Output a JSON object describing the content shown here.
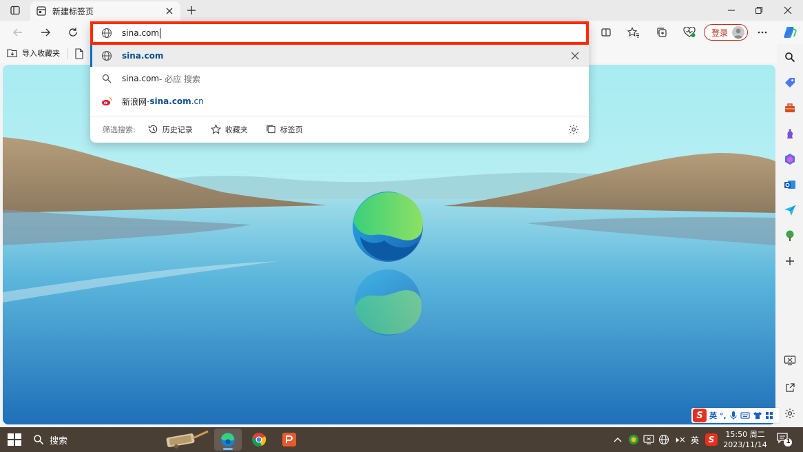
{
  "tab": {
    "title": "新建标签页"
  },
  "address": {
    "value": "sina.com"
  },
  "suggestions": [
    {
      "kind": "url",
      "text": "sina.com"
    },
    {
      "kind": "search",
      "query": "sina.com",
      "suffix": " - 必应 搜索"
    },
    {
      "kind": "site",
      "name": "新浪网",
      "sep": " - ",
      "domain_bold": "sina.com",
      "domain_rest": ".cn"
    }
  ],
  "filters": {
    "label": "筛选搜索:",
    "history": "历史记录",
    "favorites": "收藏夹",
    "tabs": "标签页"
  },
  "toolbar": {
    "login_label": "登录"
  },
  "favorites_bar": {
    "import_label": "导入收藏夹"
  },
  "ime": {
    "lang": "英",
    "punct": "°,",
    "logo": "S"
  },
  "taskbar": {
    "search_label": "搜索",
    "tray_volume": "🕨×",
    "tray_lang": "英",
    "time": "15:50 周二",
    "date": "2023/11/14",
    "notification_count": "1"
  },
  "colors": {
    "accent": "#0f6cbd",
    "highlight_border": "#ff2a00",
    "login_red": "#c42b1c",
    "taskbar": "#4a3f35"
  }
}
